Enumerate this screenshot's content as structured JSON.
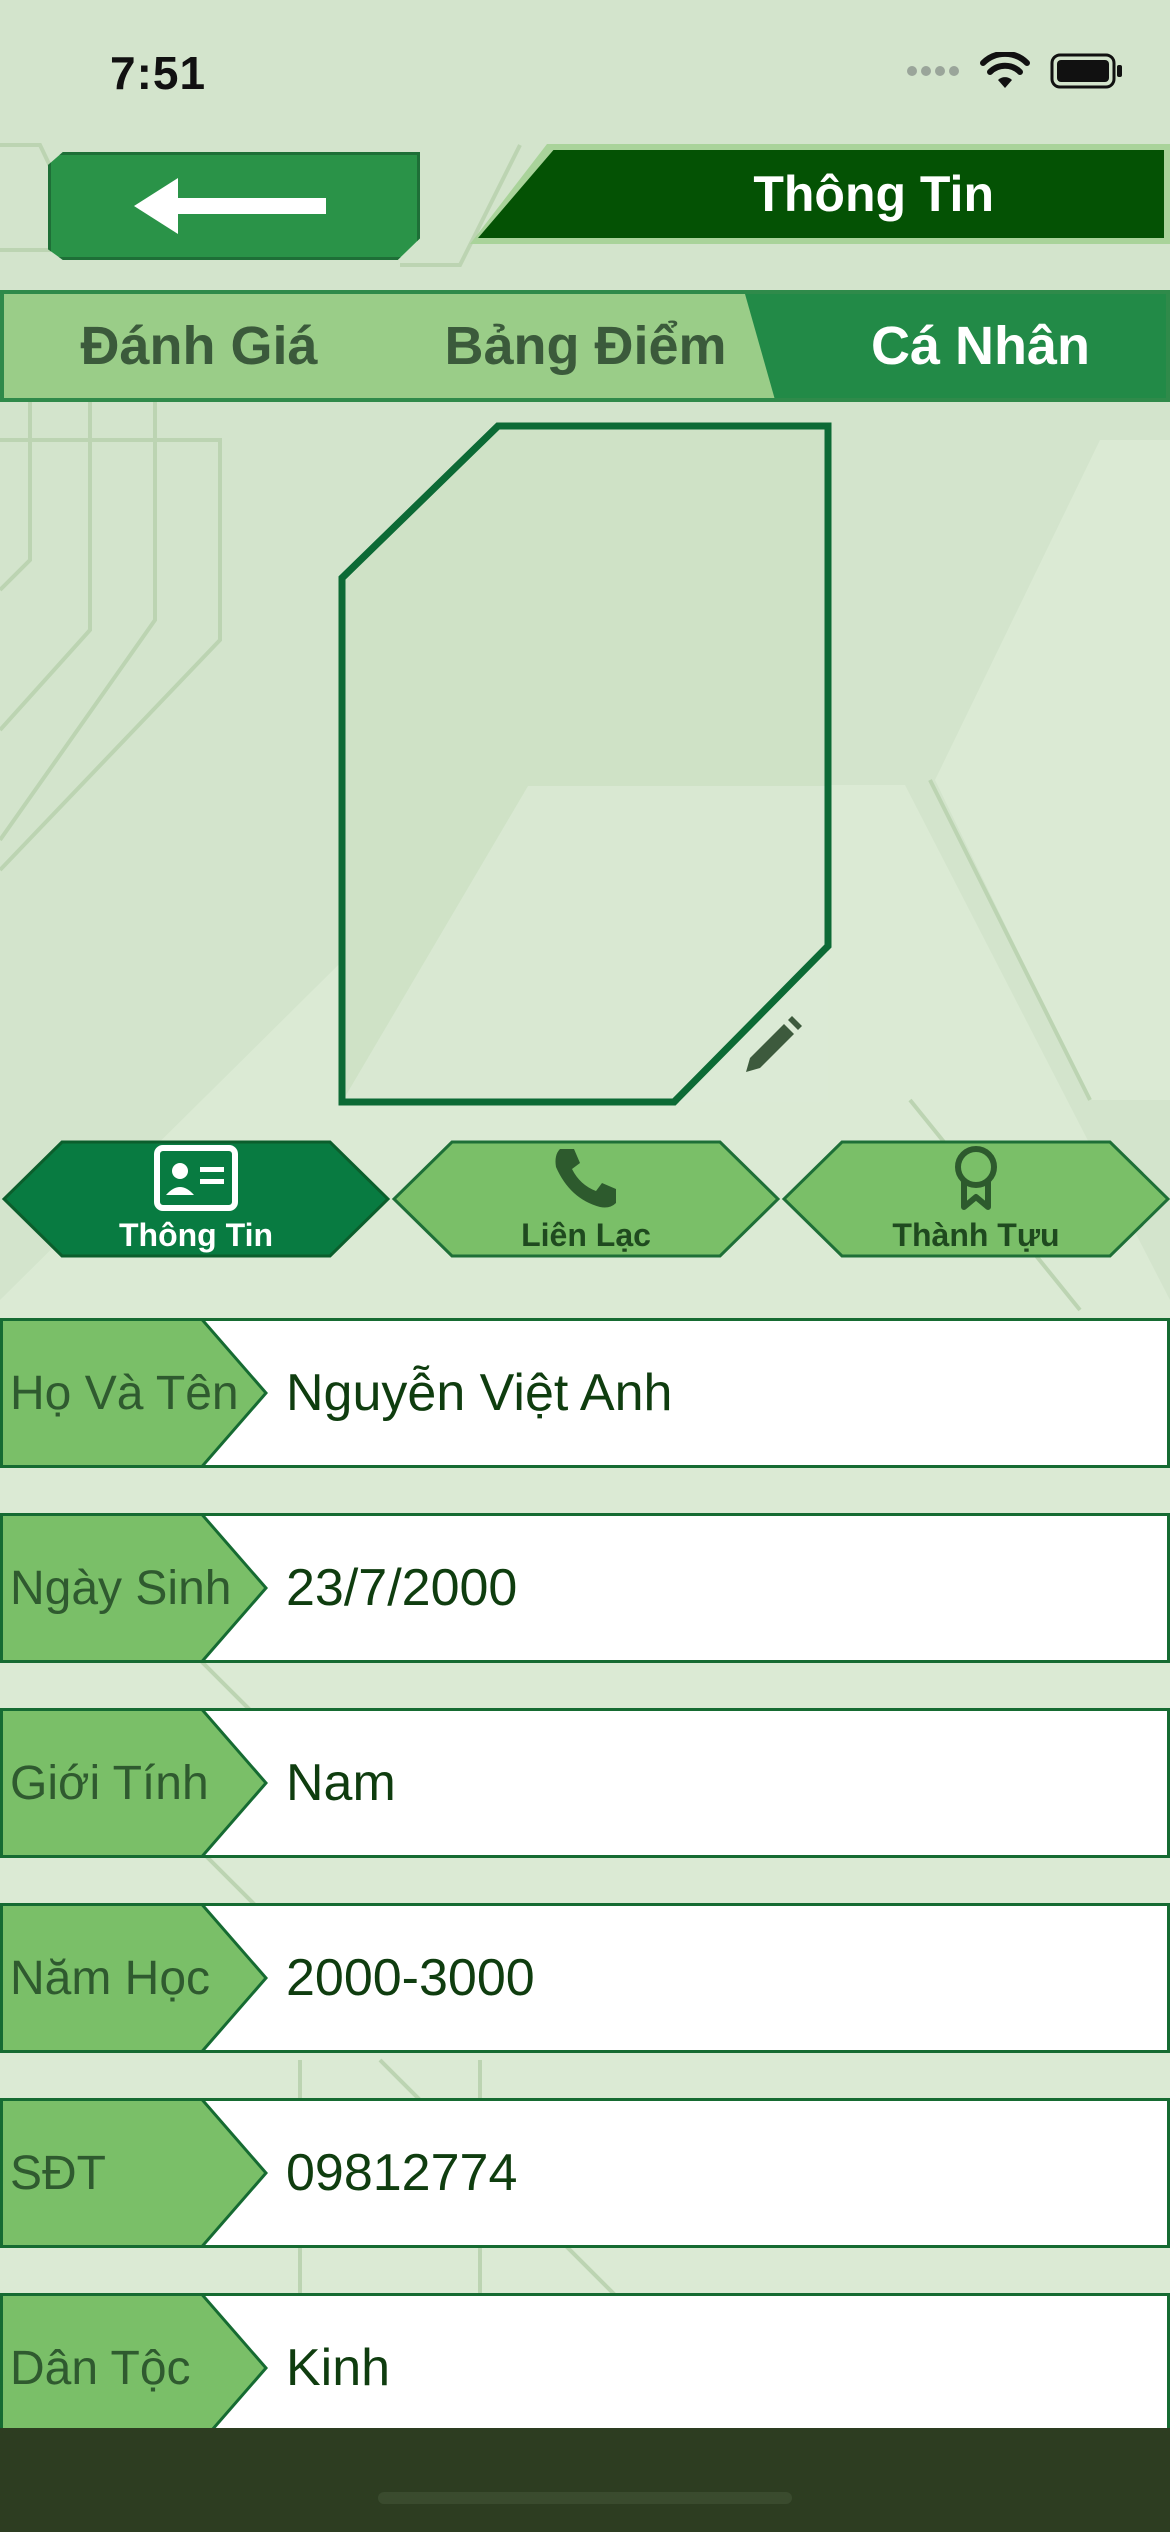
{
  "status_bar": {
    "time": "7:51",
    "icons": [
      "signal-dots-icon",
      "wifi-icon",
      "battery-icon"
    ]
  },
  "nav": {
    "back_icon": "arrow-left-icon",
    "title": "Thông Tin"
  },
  "segments": [
    {
      "label": "Đánh Giá",
      "active": false
    },
    {
      "label": "Bảng Điểm",
      "active": false
    },
    {
      "label": "Cá Nhân",
      "active": true
    }
  ],
  "avatar": {
    "edit_icon": "pencil-icon"
  },
  "section_tabs": [
    {
      "label": "Thông Tin",
      "icon": "id-card-icon",
      "active": true
    },
    {
      "label": "Liên Lạc",
      "icon": "phone-icon",
      "active": false
    },
    {
      "label": "Thành Tựu",
      "icon": "award-icon",
      "active": false
    }
  ],
  "info_rows": [
    {
      "label": "Họ Và Tên",
      "value": "Nguyễn Việt Anh"
    },
    {
      "label": "Ngày Sinh",
      "value": "23/7/2000"
    },
    {
      "label": "Giới Tính",
      "value": "Nam"
    },
    {
      "label": "Năm Học",
      "value": "2000-3000"
    },
    {
      "label": "SĐT",
      "value": "09812774"
    },
    {
      "label": "Dân Tộc",
      "value": "Kinh"
    }
  ],
  "colors": {
    "background": "#d3e4cc",
    "primary_dark": "#045204",
    "primary": "#228a47",
    "active_tab": "#087b41",
    "inactive_tab": "#7abf68",
    "label_tag": "#7abf68",
    "border": "#166b32",
    "bottom_bar": "#2d3d21"
  }
}
